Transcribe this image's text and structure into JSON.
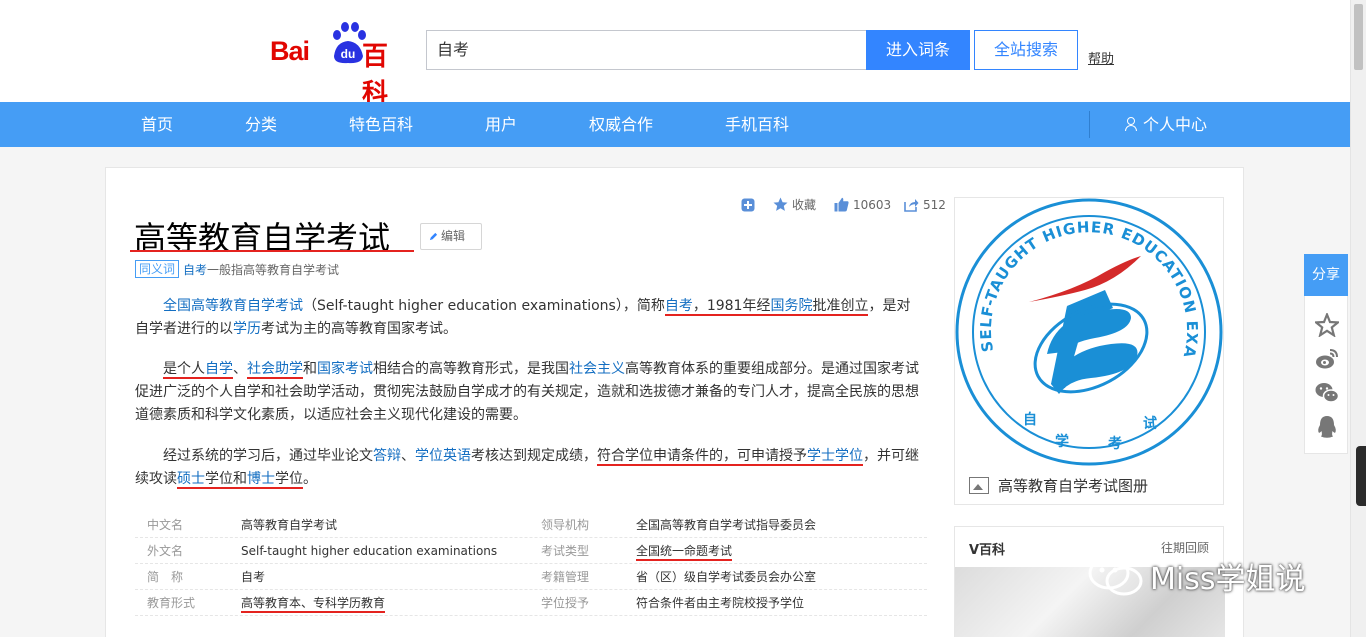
{
  "header": {
    "logo_text_left": "Bai",
    "logo_text_right": "百科",
    "logo_paw_text": "du",
    "search_value": "自考",
    "enter_button": "进入词条",
    "site_search_button": "全站搜索",
    "help_link": "帮助"
  },
  "nav": {
    "items": [
      "首页",
      "分类",
      "特色百科",
      "用户",
      "权威合作",
      "手机百科"
    ],
    "personal_center": "个人中心"
  },
  "entry": {
    "title": "高等教育自学考试",
    "edit_button": "编辑",
    "synonym_tag": "同义词",
    "synonym_link": "自考",
    "synonym_text": "一般指高等教育自学考试",
    "actions": {
      "add_icon": "plus-square-icon",
      "favorite_label": "收藏",
      "like_count": "10603",
      "share_count": "512"
    }
  },
  "paragraphs": {
    "p1": {
      "s1": "全国高等教育自学考试",
      "s2": "（Self-taught higher education examinations），简称",
      "s3": "自考",
      "s4": "，1981年经",
      "s5": "国务院",
      "s6": "批准创立",
      "s7": "，是对自学者进行的以",
      "s8": "学历",
      "s9": "考试为主的高等教育国家考试。"
    },
    "p2": {
      "s1": "是个人",
      "s2": "自学",
      "s3": "、",
      "s4": "社会助学",
      "s5": "和",
      "s6": "国家考试",
      "s7": "相结合的高等教育形式，是我国",
      "s8": "社会主义",
      "s9": "高等教育体系的重要组成部分。是通过国家考试促进广泛的个人自学和社会助学活动，贯彻宪法鼓励自学成才的有关规定，造就和选拔德才兼备的专门人才，提高全民族的思想道德素质和科学文化素质，以适应社会主义现代化建设的需要。"
    },
    "p3": {
      "s1": "经过系统的学习后，通过毕业论文",
      "s2": "答辩",
      "s3": "、",
      "s4": "学位英语",
      "s5": "考核达到规定成绩，",
      "s6": "符合学位申请条件的，可申请授予",
      "s7": "学士学位",
      "s8": "，并可继续攻读",
      "s9": "硕士",
      "s10": "学位和",
      "s11": "博士",
      "s12": "学位",
      "s13": "。"
    }
  },
  "basic_info": [
    {
      "k1": "中文名",
      "v1": "高等教育自学考试",
      "k2": "领导机构",
      "v2": "全国高等教育自学考试指导委员会"
    },
    {
      "k1": "外文名",
      "v1": "Self-taught higher education examinations",
      "k2": "考试类型",
      "v2": "全国统一命题考试"
    },
    {
      "k1": "简　称",
      "v1": "自考",
      "k2": "考籍管理",
      "v2": "省（区）级自学考试委员会办公室"
    },
    {
      "k1": "教育形式",
      "v1": "高等教育本、专科学历教育",
      "k2": "学位授予",
      "v2": "符合条件者由主考院校授予学位"
    }
  ],
  "album": {
    "caption": "高等教育自学考试图册",
    "emblem_ring_text": "SELF-TAUGHT HIGHER EDUCATION EXAMINATIONS",
    "emblem_bottom_text": [
      "自",
      "学",
      "考",
      "试"
    ],
    "colors": {
      "ring": "#1a8fd6",
      "flame": "#d42a2a"
    }
  },
  "vbaike": {
    "title": "V百科",
    "more_link": "往期回顾"
  },
  "share": {
    "label": "分享",
    "icons": [
      "star-icon",
      "weibo-icon",
      "wechat-icon",
      "qq-icon"
    ]
  },
  "watermark": {
    "text": "Miss学姐说"
  },
  "colors": {
    "brand_blue": "#459df5",
    "button_blue": "#3385ff",
    "link_blue": "#136ec2",
    "baidu_red": "#e10601",
    "annotation_red": "#e4231f"
  }
}
